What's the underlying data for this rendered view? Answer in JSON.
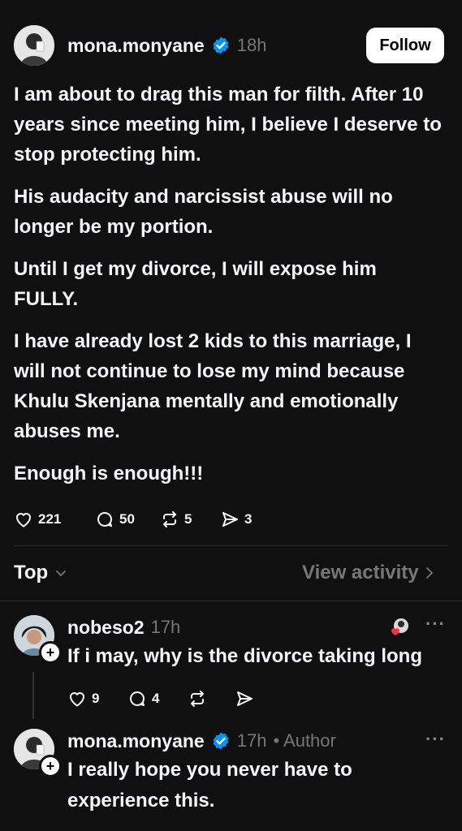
{
  "post": {
    "username": "mona.monyane",
    "time": "18h",
    "follow_label": "Follow",
    "paragraphs": [
      "I am about to drag this man for filth. After 10 years since meeting him, I believe I deserve to stop protecting him.",
      "His audacity and narcissist abuse will no longer be my portion.",
      "Until I get my divorce, I will expose him FULLY.",
      "I have already lost 2 kids to this marriage, I will not continue to lose my mind because Khulu Skenjana mentally and emotionally abuses me.",
      "Enough is enough!!!"
    ],
    "likes": "221",
    "comments": "50",
    "reposts": "5",
    "shares": "3"
  },
  "sort": {
    "label": "Top",
    "view_activity": "View activity"
  },
  "replies": [
    {
      "username": "nobeso2",
      "time": "17h",
      "text": "If i may, why is the divorce taking long",
      "likes": "9",
      "comments": "4"
    },
    {
      "username": "mona.monyane",
      "time": "17h",
      "author_tag": "• Author",
      "text": "I really hope you never have to experience this."
    }
  ],
  "colors": {
    "background": "#101010",
    "text": "#f3f5f7",
    "muted": "#777777",
    "verified": "#0095f6",
    "heart": "#ff3040"
  },
  "icons": [
    "heart-icon",
    "comment-icon",
    "repost-icon",
    "share-icon",
    "verified-icon",
    "chevron-down-icon",
    "chevron-right-icon",
    "more-icon",
    "plus-icon"
  ]
}
